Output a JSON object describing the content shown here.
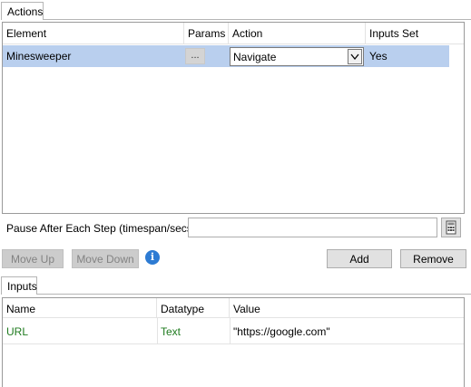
{
  "actions_tab": {
    "label": "Actions",
    "columns": [
      "Element",
      "Params",
      "Action",
      "Inputs Set"
    ],
    "rows": [
      {
        "element": "Minesweeper",
        "params_button": "...",
        "action": "Navigate",
        "inputs_set": "Yes"
      }
    ]
  },
  "pause": {
    "label": "Pause After Each Step (timespan/secs)",
    "value": "",
    "calculator_icon": "calculator-icon"
  },
  "buttons": {
    "move_up": "Move Up",
    "move_down": "Move Down",
    "info_icon": "info-icon",
    "add": "Add",
    "remove": "Remove"
  },
  "inputs_tab": {
    "label": "Inputs",
    "columns": [
      "Name",
      "Datatype",
      "Value"
    ],
    "rows": [
      {
        "name": "URL",
        "datatype": "Text",
        "value": "\"https://google.com\""
      }
    ]
  },
  "colors": {
    "selection": "#b9cfee",
    "input_text": "#1e7a1e",
    "info_icon": "#2d7bd3",
    "disabled_button": "#cccccc"
  }
}
